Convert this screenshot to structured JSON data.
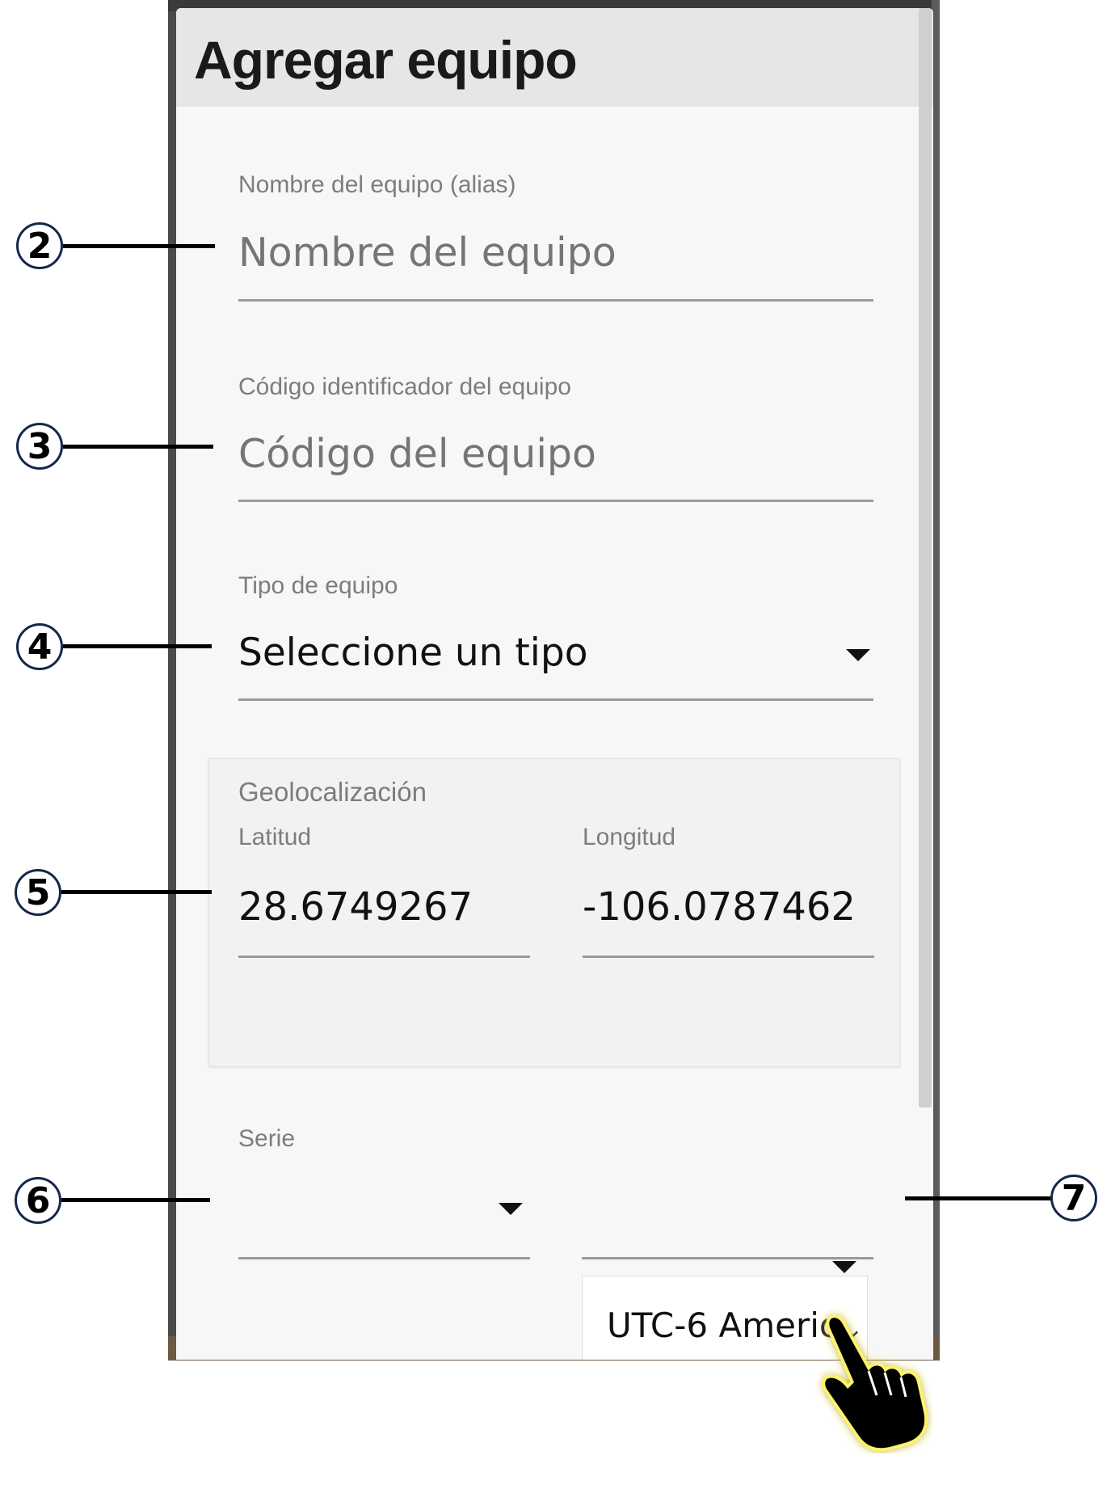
{
  "dialog": {
    "title": "Agregar equipo"
  },
  "fields": {
    "name": {
      "label": "Nombre del equipo (alias)",
      "placeholder": "Nombre del equipo",
      "value": ""
    },
    "code": {
      "label": "Código identificador del equipo",
      "placeholder": "Código del equipo",
      "value": ""
    },
    "type": {
      "label": "Tipo de equipo",
      "selected": "Seleccione un tipo"
    },
    "geolocation": {
      "title": "Geolocalización",
      "latitude_label": "Latitud",
      "latitude_value": "28.6749267",
      "longitude_label": "Longitud",
      "longitude_value": "-106.0787462"
    },
    "serie": {
      "label": "Serie",
      "selected": ""
    },
    "timezone": {
      "selected": "UTC-6 Americ"
    }
  },
  "callouts": [
    "2",
    "3",
    "4",
    "5",
    "6",
    "7"
  ],
  "icons": {
    "caret": "caret-down-icon",
    "chevron": "chevron-down-icon",
    "pointer": "hand-pointer-icon"
  },
  "colors": {
    "header_bg": "#e6e6e6",
    "dialog_bg": "#f7f7f7",
    "callout_border": "#13284a",
    "pointer_glow": "#fff36b"
  }
}
